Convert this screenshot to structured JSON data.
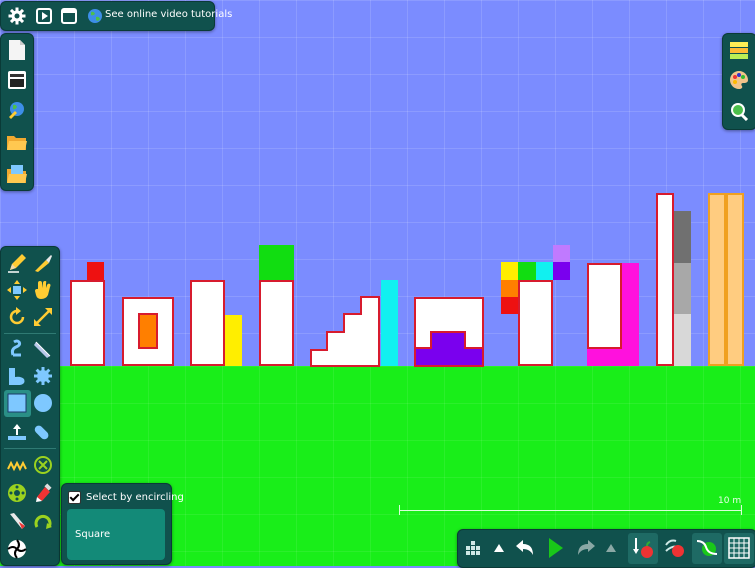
{
  "top_bar": {
    "tutorials_label": "See online video tutorials"
  },
  "selection_panel": {
    "encircle_label": "Select by encircling",
    "shape_label": "Square"
  },
  "scale": {
    "label": "10 m"
  },
  "colors": {
    "sky": "#7b8cff",
    "ground": "#19ee19",
    "panel": "#10514d",
    "block_outline": "#d71b2e"
  },
  "icons": {
    "top_bar": [
      "gear-icon",
      "play-scene-icon",
      "window-icon",
      "globe-icon"
    ],
    "left_file": [
      "new-document-icon",
      "scene-manager-icon",
      "load-web-icon",
      "open-folder-icon",
      "save-folder-icon"
    ],
    "right_top": [
      "layers-icon",
      "palette-icon",
      "zoom-icon"
    ],
    "left_tools": [
      "draw-pencil-icon",
      "knife-icon",
      "move-icon",
      "drag-hand-icon",
      "rotate-icon",
      "scale-icon",
      "rope-icon",
      "cut-icon",
      "polygon-icon",
      "gear-shape-icon",
      "box-icon",
      "circle-icon",
      "plane-icon",
      "spring-tool-icon",
      "spring-icon",
      "remove-icon",
      "hinge-icon",
      "tracer-icon",
      "laser-icon",
      "thruster-icon",
      "fixate-icon"
    ],
    "bottom_bar": [
      "menu-grid-icon",
      "arrow-up-icon",
      "undo-icon",
      "play-icon",
      "redo-icon",
      "arrow-up-small-icon",
      "gravity-icon",
      "air-friction-icon",
      "collision-icon",
      "grid-icon"
    ]
  }
}
